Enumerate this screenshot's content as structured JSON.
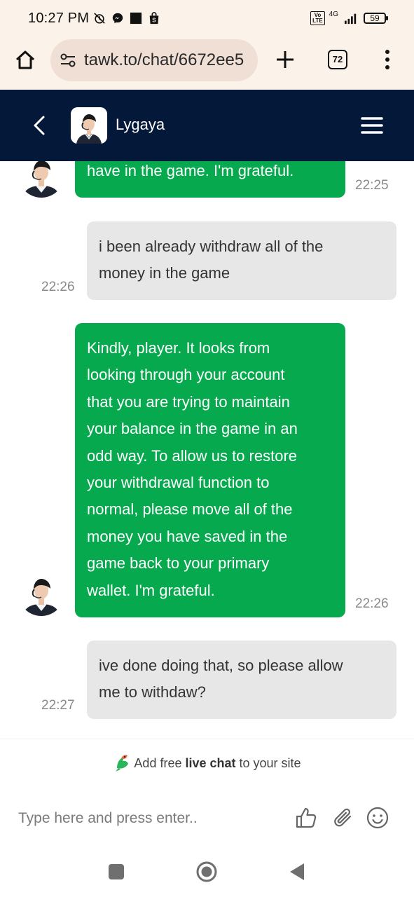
{
  "status_bar": {
    "time": "10:27 PM",
    "network": "4G",
    "volte": "Vo\nLTE",
    "battery": "59"
  },
  "browser": {
    "url": "tawk.to/chat/6672ee5",
    "tab_count": "72"
  },
  "chat": {
    "agent_name": "Lygaya",
    "messages": [
      {
        "sender": "agent",
        "text": "have in the game. I'm grateful.",
        "time": "22:25"
      },
      {
        "sender": "user",
        "text": "i been already withdraw all of the\nmoney in the game",
        "time": "22:26"
      },
      {
        "sender": "agent",
        "text": "Kindly, player. It looks from\nlooking through your account\nthat you are trying to maintain\nyour balance in the game in an\nodd way. To allow us to restore\nyour withdrawal function to\nnormal, please move all of the\nmoney you have saved in the\ngame back to your primary\nwallet. I'm grateful.",
        "time": "22:26"
      },
      {
        "sender": "user",
        "text": "ive done doing that, so please allow\nme to withdaw?",
        "time": "22:27"
      }
    ]
  },
  "footer": {
    "branding_prefix": "Add free ",
    "branding_bold": "live chat",
    "branding_suffix": " to your site",
    "input_placeholder": "Type here and press enter.."
  },
  "colors": {
    "header_bg": "#04183a",
    "agent_bubble": "#06a94d",
    "user_bubble": "#e7e7e7",
    "browser_chrome": "#fbf2ea"
  },
  "icons": {
    "browser": [
      "home-icon",
      "site-settings-icon",
      "plus-icon",
      "tab-switcher-icon",
      "more-vert-icon"
    ],
    "header": [
      "chevron-left-icon",
      "hamburger-menu-icon"
    ],
    "composer": [
      "thumbs-up-icon",
      "paperclip-icon",
      "emoji-icon"
    ],
    "nav": [
      "recents-icon",
      "home-circle-icon",
      "back-triangle-icon"
    ]
  }
}
